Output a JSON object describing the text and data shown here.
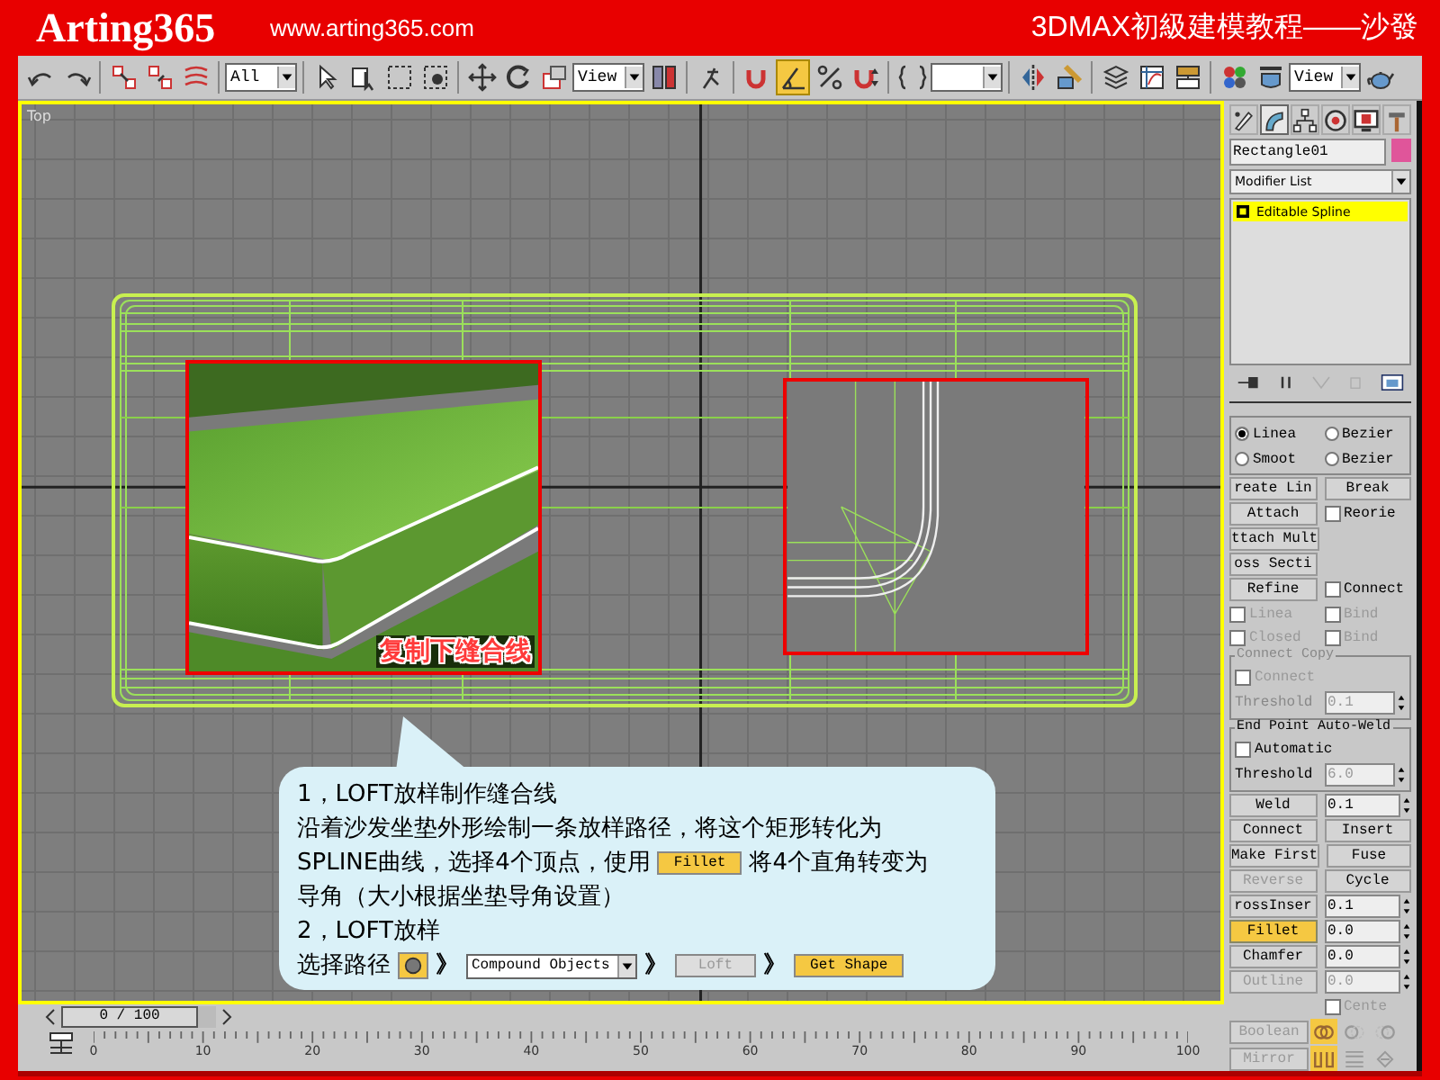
{
  "header": {
    "logo": "Arting365",
    "url": "www.arting365.com",
    "title": "3DMAX初級建模教程——沙發"
  },
  "toolbar": {
    "items": [
      {
        "kind": "undo"
      },
      {
        "kind": "redo"
      },
      {
        "kind": "separator"
      },
      {
        "kind": "link"
      },
      {
        "kind": "unlink"
      },
      {
        "kind": "bind"
      },
      {
        "kind": "separator"
      },
      {
        "kind": "dropdown",
        "value": "All"
      },
      {
        "kind": "separator"
      },
      {
        "kind": "select"
      },
      {
        "kind": "select-name"
      },
      {
        "kind": "region"
      },
      {
        "kind": "crossing"
      },
      {
        "kind": "separator"
      },
      {
        "kind": "move"
      },
      {
        "kind": "rotate"
      },
      {
        "kind": "scale"
      },
      {
        "kind": "dropdown",
        "value": "View"
      },
      {
        "kind": "pivot"
      },
      {
        "kind": "separator"
      },
      {
        "kind": "manipulate"
      },
      {
        "kind": "separator"
      },
      {
        "kind": "snap",
        "active": false
      },
      {
        "kind": "angle-snap",
        "active": true
      },
      {
        "kind": "percent-snap",
        "active": false
      },
      {
        "kind": "spinner-snap",
        "active": false
      },
      {
        "kind": "separator"
      },
      {
        "kind": "named-selection"
      },
      {
        "kind": "dropdown"
      },
      {
        "kind": "separator"
      },
      {
        "kind": "mirror"
      },
      {
        "kind": "align"
      },
      {
        "kind": "separator"
      },
      {
        "kind": "layers"
      },
      {
        "kind": "curve-editor"
      },
      {
        "kind": "schematic"
      },
      {
        "kind": "separator"
      },
      {
        "kind": "material"
      },
      {
        "kind": "render"
      },
      {
        "kind": "dropdown",
        "value": "View"
      },
      {
        "kind": "teapot"
      }
    ]
  },
  "viewport": {
    "label": "Top",
    "insets": [
      {
        "caption": "复制下缝合线"
      }
    ]
  },
  "callout": {
    "lines": [
      [
        {
          "kind": "text",
          "text": "1，LOFT放样制作缝合线"
        }
      ],
      [
        {
          "kind": "text",
          "text": "沿着沙发坐垫外形绘制一条放样路径，将这个矩形转化为"
        }
      ],
      [
        {
          "kind": "text",
          "text": "SPLINE曲线，选择4个顶点，使用"
        },
        {
          "kind": "button",
          "label": "Fillet",
          "active": true
        },
        {
          "kind": "text",
          "text": "将4个直角转变为"
        }
      ],
      [
        {
          "kind": "text",
          "text": "导角（大小根据坐垫导角设置）"
        }
      ],
      [
        {
          "kind": "text",
          "text": "2，LOFT放样"
        }
      ],
      [
        {
          "kind": "text",
          "text": "选择路径"
        },
        {
          "kind": "sphere-button"
        },
        {
          "kind": "arrow",
          "text": "》"
        },
        {
          "kind": "dropdown",
          "value": "Compound Objects"
        },
        {
          "kind": "arrow",
          "text": "》"
        },
        {
          "kind": "button",
          "label": "Loft",
          "disabled": true
        },
        {
          "kind": "arrow",
          "text": "》"
        },
        {
          "kind": "button",
          "label": "Get Shape",
          "active": true
        }
      ]
    ]
  },
  "time_slider": {
    "label": "0 / 100",
    "level": 0
  },
  "ruler": {
    "labels": [
      "0",
      "10",
      "20",
      "30",
      "40",
      "50",
      "60",
      "70",
      "80",
      "90",
      "100"
    ]
  },
  "command_panel": {
    "tabs": [
      {
        "selected": false
      },
      {
        "selected": true
      },
      {
        "selected": false
      },
      {
        "selected": false
      },
      {
        "selected": false
      },
      {
        "selected": false
      }
    ],
    "object_name": "Rectangle01",
    "modifier_list": "Modifier List",
    "stack": [
      {
        "label": "Editable Spline",
        "selected": true
      }
    ],
    "rollout": [
      {
        "kind": "group",
        "rows": [
          [
            {
              "kind": "radio",
              "label": "Linea",
              "selected": true
            },
            {
              "kind": "radio",
              "label": "Bezier",
              "selected": false
            }
          ],
          [
            {
              "kind": "radio",
              "label": "Smoot",
              "selected": false
            },
            {
              "kind": "radio",
              "label": "Bezier",
              "selected": false
            }
          ]
        ]
      },
      {
        "kind": "row",
        "items": [
          {
            "kind": "button",
            "label": "reate Lin"
          },
          {
            "kind": "button",
            "label": "Break"
          }
        ]
      },
      {
        "kind": "row",
        "items": [
          {
            "kind": "button",
            "label": "Attach"
          },
          {
            "kind": "checkbox",
            "label": "Reorie",
            "checked": false
          }
        ]
      },
      {
        "kind": "row",
        "items": [
          {
            "kind": "button",
            "label": "ttach Mult"
          }
        ]
      },
      {
        "kind": "row",
        "items": [
          {
            "kind": "button",
            "label": "oss Secti"
          }
        ]
      },
      {
        "kind": "row",
        "items": [
          {
            "kind": "button",
            "label": "Refine"
          },
          {
            "kind": "checkbox",
            "label": "Connect",
            "checked": false
          }
        ]
      },
      {
        "kind": "row",
        "items": [
          {
            "kind": "checkbox",
            "label": "Linea",
            "checked": false,
            "disabled": true
          },
          {
            "kind": "checkbox",
            "label": "Bind",
            "checked": false,
            "disabled": true
          }
        ]
      },
      {
        "kind": "row",
        "items": [
          {
            "kind": "checkbox",
            "label": "Closed",
            "checked": false,
            "disabled": true
          },
          {
            "kind": "checkbox",
            "label": "Bind",
            "checked": false,
            "disabled": true
          }
        ]
      },
      {
        "kind": "group",
        "title": "Connect Copy",
        "disabled": true,
        "rows": [
          [
            {
              "kind": "checkbox",
              "label": "Connect",
              "checked": false,
              "disabled": true
            }
          ],
          [
            {
              "kind": "label",
              "text": "Threshold",
              "disabled": true
            },
            {
              "kind": "field",
              "value": "0.1",
              "disabled": true
            }
          ]
        ]
      },
      {
        "kind": "group",
        "title": "End Point Auto-Weld",
        "disabled": false,
        "rows": [
          [
            {
              "kind": "checkbox",
              "label": "Automatic",
              "checked": false
            }
          ],
          [
            {
              "kind": "label",
              "text": "Threshold"
            },
            {
              "kind": "field",
              "value": "6.0",
              "disabled": true
            }
          ]
        ]
      },
      {
        "kind": "row",
        "items": [
          {
            "kind": "button",
            "label": "Weld"
          },
          {
            "kind": "field",
            "value": "0.1"
          }
        ]
      },
      {
        "kind": "row",
        "items": [
          {
            "kind": "button",
            "label": "Connect"
          },
          {
            "kind": "button",
            "label": "Insert"
          }
        ]
      },
      {
        "kind": "row",
        "items": [
          {
            "kind": "button",
            "label": "Make First"
          },
          {
            "kind": "button",
            "label": "Fuse"
          }
        ]
      },
      {
        "kind": "row",
        "items": [
          {
            "kind": "button",
            "label": "Reverse",
            "disabled": true
          },
          {
            "kind": "button",
            "label": "Cycle"
          }
        ]
      },
      {
        "kind": "row",
        "items": [
          {
            "kind": "button",
            "label": "rossInser"
          },
          {
            "kind": "field",
            "value": "0.1"
          }
        ]
      },
      {
        "kind": "row",
        "items": [
          {
            "kind": "button",
            "label": "Fillet",
            "active": true
          },
          {
            "kind": "field",
            "value": "0.0"
          }
        ]
      },
      {
        "kind": "row",
        "items": [
          {
            "kind": "button",
            "label": "Chamfer"
          },
          {
            "kind": "field",
            "value": "0.0"
          }
        ]
      },
      {
        "kind": "row",
        "items": [
          {
            "kind": "button",
            "label": "Outline",
            "disabled": true
          },
          {
            "kind": "field",
            "value": "0.0",
            "disabled": true
          }
        ]
      },
      {
        "kind": "row",
        "items": [
          {
            "kind": "checkbox",
            "label": "Cente",
            "checked": false,
            "disabled": true
          }
        ]
      },
      {
        "kind": "row",
        "items": [
          {
            "kind": "button",
            "label": "Boolean",
            "disabled": true
          },
          {
            "kind": "union",
            "selected": true
          },
          {
            "kind": "subtraction",
            "selected": false
          },
          {
            "kind": "intersection",
            "selected": false
          }
        ]
      },
      {
        "kind": "row",
        "items": [
          {
            "kind": "button",
            "label": "Mirror",
            "disabled": true
          },
          {
            "kind": "mirror-h",
            "selected": true
          },
          {
            "kind": "mirror-v",
            "selected": false
          },
          {
            "kind": "mirror-both",
            "selected": false
          }
        ]
      }
    ]
  }
}
